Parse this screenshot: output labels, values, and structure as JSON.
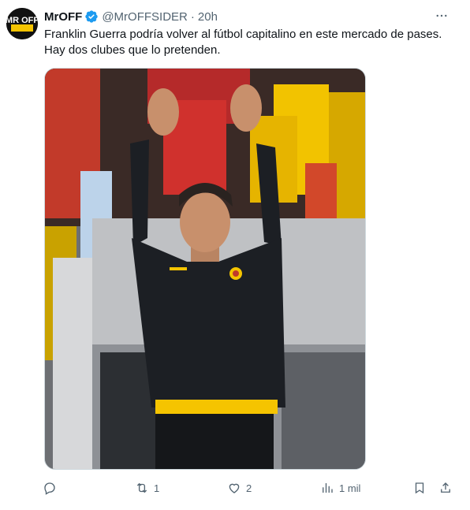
{
  "author": {
    "name": "MrOFF",
    "handle": "@MrOFFSIDER",
    "separator": "·",
    "time": "20h",
    "avatar_text": "MR OFF",
    "verified": true
  },
  "tweet": {
    "text_line1": "Franklin Guerra podría volver al fútbol capitalino en este mercado de pases.",
    "text_line2": "Hay dos clubes que lo pretenden."
  },
  "actions": {
    "reply_count": "",
    "retweet_count": "1",
    "like_count": "2",
    "views_count": "1 mil"
  },
  "icons": {
    "more": "more-icon",
    "verified": "verified-badge-icon",
    "reply": "reply-icon",
    "retweet": "retweet-icon",
    "like": "heart-icon",
    "views": "views-chart-icon",
    "bookmark": "bookmark-icon",
    "share": "share-icon"
  },
  "colors": {
    "text": "#0f1419",
    "muted": "#536471",
    "verified": "#1d9bf0",
    "jacket": "#1c1f24",
    "accent_yellow": "#f5c400"
  }
}
